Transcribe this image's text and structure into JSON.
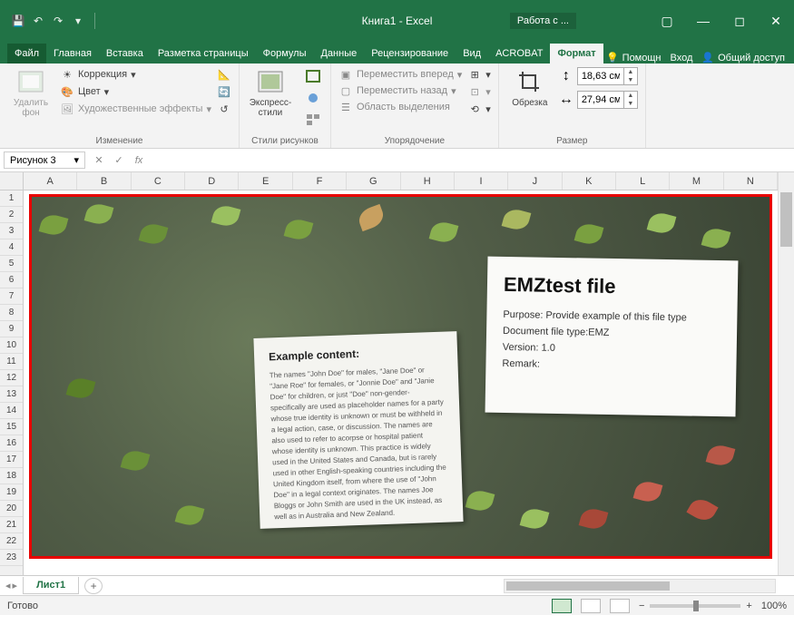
{
  "titlebar": {
    "app_title": "Книга1 - Excel",
    "context_label": "Работа с ..."
  },
  "tabs": {
    "file": "Файл",
    "items": [
      "Главная",
      "Вставка",
      "Разметка страницы",
      "Формулы",
      "Данные",
      "Рецензирование",
      "Вид",
      "ACROBAT"
    ],
    "format": "Формат",
    "help": "Помощн",
    "signin": "Вход",
    "share": "Общий доступ"
  },
  "ribbon": {
    "remove_bg": "Удалить фон",
    "corrections": "Коррекция",
    "color": "Цвет",
    "art_effects": "Художественные эффекты",
    "group_adjust": "Изменение",
    "express_styles": "Экспресс-стили",
    "group_styles": "Стили рисунков",
    "bring_forward": "Переместить вперед",
    "send_backward": "Переместить назад",
    "selection_pane": "Область выделения",
    "group_arrange": "Упорядочение",
    "crop": "Обрезка",
    "height_value": "18,63 см",
    "width_value": "27,94 см",
    "group_size": "Размер"
  },
  "formula_bar": {
    "name": "Рисунок 3",
    "fx": "fx"
  },
  "columns": [
    "A",
    "B",
    "C",
    "D",
    "E",
    "F",
    "G",
    "H",
    "I",
    "J",
    "K",
    "L",
    "M",
    "N"
  ],
  "rows": [
    "1",
    "2",
    "3",
    "4",
    "5",
    "6",
    "7",
    "8",
    "9",
    "10",
    "11",
    "12",
    "13",
    "14",
    "15",
    "16",
    "17",
    "18",
    "19",
    "20",
    "21",
    "22",
    "23"
  ],
  "picture": {
    "paper1_title": "Example content:",
    "paper1_body": "The names \"John Doe\" for males, \"Jane Doe\" or \"Jane Roe\" for females, or \"Jonnie Doe\" and \"Janie Doe\" for children, or just \"Doe\" non-gender-specifically are used as placeholder names for a party whose true identity is unknown or must be withheld in a legal action, case, or discussion. The names are also used to refer to acorpse or hospital patient whose identity is unknown. This practice is widely used in the United States and Canada, but is rarely used in other English-speaking countries including the United Kingdom itself, from where the use of \"John Doe\" in a legal context originates. The names Joe Bloggs or John Smith are used in the UK instead, as well as in Australia and New Zealand.",
    "paper2_title": "EMZtest file",
    "paper2_purpose": "Purpose: Provide example of this file type",
    "paper2_doctype": "Document file type:EMZ",
    "paper2_version": "Version: 1.0",
    "paper2_remark": "Remark:"
  },
  "sheets": {
    "sheet1": "Лист1"
  },
  "statusbar": {
    "ready": "Готово",
    "zoom": "100%"
  }
}
